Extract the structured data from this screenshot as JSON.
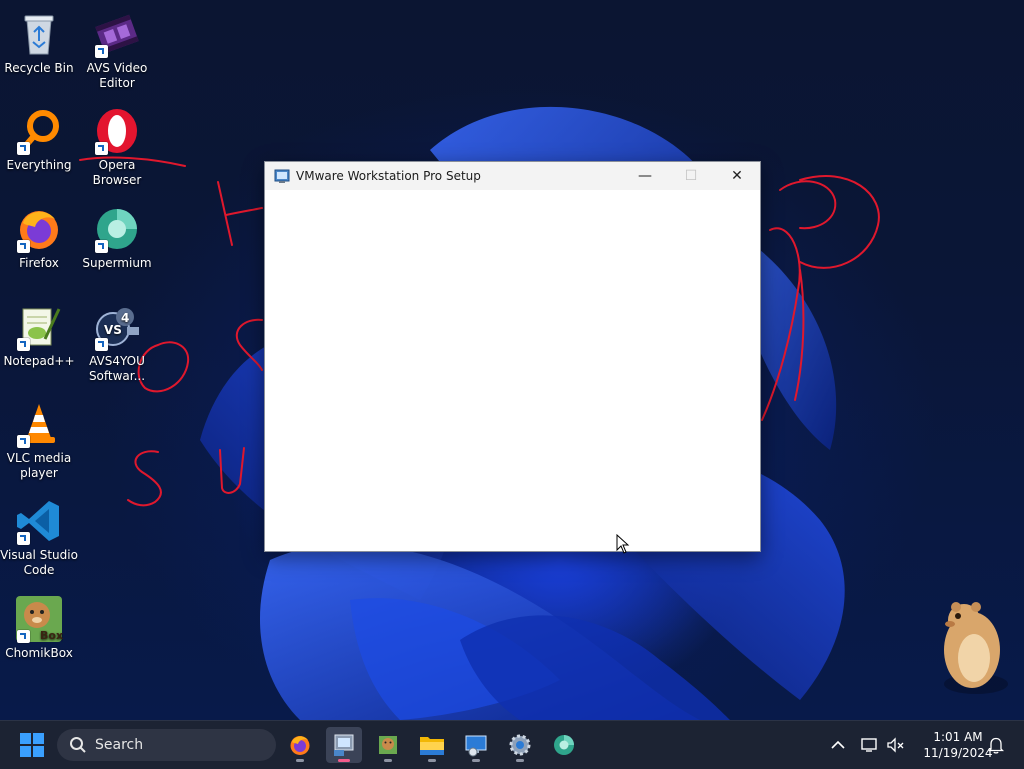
{
  "desktop": {
    "icons": [
      {
        "label": "Recycle Bin",
        "icon": "recycle-bin-icon"
      },
      {
        "label": "AVS Video Editor",
        "icon": "film-icon"
      },
      {
        "label": "Everything",
        "icon": "magnifier-icon"
      },
      {
        "label": "Opera Browser",
        "icon": "opera-icon"
      },
      {
        "label": "Firefox",
        "icon": "firefox-icon"
      },
      {
        "label": "Supermium",
        "icon": "supermium-icon"
      },
      {
        "label": "Notepad++",
        "icon": "notepad-icon"
      },
      {
        "label": "AVS4YOU Softwar...",
        "icon": "avs4you-icon"
      },
      {
        "label": "VLC media player",
        "icon": "vlc-cone-icon"
      },
      {
        "label": "Visual Studio Code",
        "icon": "vscode-icon"
      },
      {
        "label": "ChomikBox",
        "icon": "hamster-icon",
        "badge": "Box"
      }
    ]
  },
  "setup_window": {
    "title": "VMware Workstation Pro Setup",
    "minimize_glyph": "—",
    "maximize_glyph": "☐",
    "close_glyph": "✕"
  },
  "taskbar": {
    "search_label": "Search",
    "apps": [
      "firefox-icon",
      "vmware-setup-icon",
      "notepad-icon",
      "file-explorer-icon",
      "remote-desktop-icon",
      "settings-gear-icon",
      "supermium-icon"
    ],
    "active_app": "vmware-setup-icon",
    "clock": {
      "time": "1:01 AM",
      "date": "11/19/2024"
    }
  },
  "colors": {
    "taskbar_bg": "#1c2333",
    "accent_active": "#f45b8c",
    "scribble_red": "#e0182d",
    "wallpaper_blue": "#1a3fd8"
  }
}
